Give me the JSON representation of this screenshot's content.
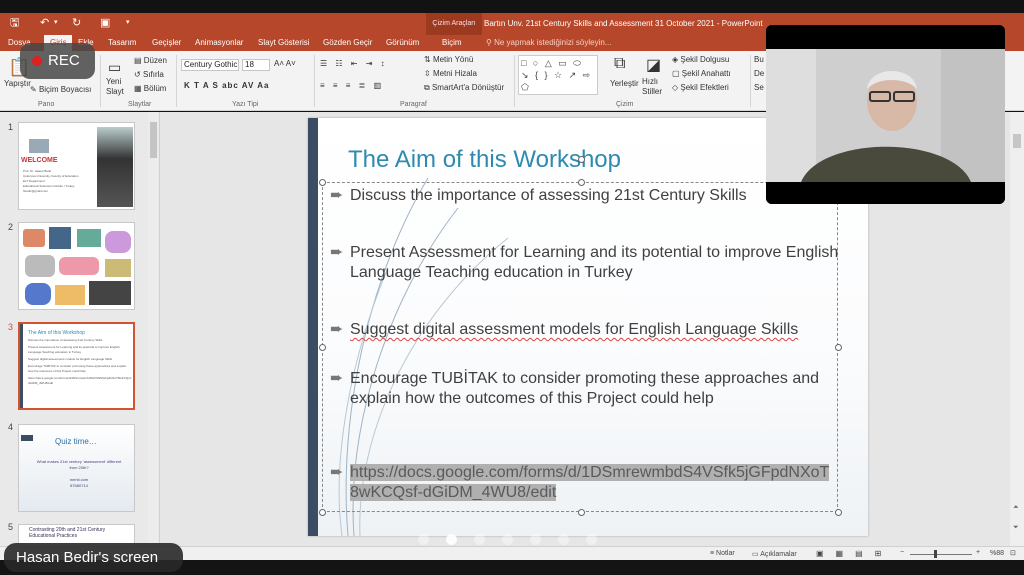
{
  "app": {
    "document_title": "Bartın Unv. 21st Century Skills and Assessment 31 October 2021 - PowerPoint",
    "context_tab_group": "Çizim Araçları",
    "tell_me": "Ne yapmak istediğinizi söyleyin..."
  },
  "ribbon_tabs": [
    {
      "label": "Dosya"
    },
    {
      "label": "Giriş"
    },
    {
      "label": "Ekle"
    },
    {
      "label": "Tasarım"
    },
    {
      "label": "Geçişler"
    },
    {
      "label": "Animasyonlar"
    },
    {
      "label": "Slayt Gösterisi"
    },
    {
      "label": "Gözden Geçir"
    },
    {
      "label": "Görünüm"
    },
    {
      "label": "Biçim"
    }
  ],
  "ribbon": {
    "paste": "Yapıştır",
    "format_painter": "Biçim Boyacısı",
    "group_clipboard": "Pano",
    "new_slide": "Yeni Slayt",
    "layout": "Düzen",
    "reset": "Sıfırla",
    "section": "Bölüm",
    "group_slides": "Slaytlar",
    "font_name": "Century Gothic",
    "font_size": "18",
    "font_buttons": "K  T  A  S  abc  AV  Aa",
    "group_font": "Yazı Tipi",
    "text_direction": "Metin Yönü",
    "align_text": "Metni Hizala",
    "smartart": "SmartArt'a Dönüştür",
    "group_paragraph": "Paragraf",
    "shape_glyphs": "□ ○ △ ▭ ⬭ ↘ { } ☆ ↗ ⇨ ⬠",
    "arrange": "Yerleştir",
    "quick_styles": "Hızlı Stiller",
    "shape_fill": "Şekil Dolgusu",
    "shape_outline": "Şekil Anahattı",
    "shape_effects": "Şekil Efektleri",
    "group_drawing": "Çizim",
    "find_cut": "Bu",
    "replace_cut": "De",
    "select_cut": "Se"
  },
  "thumbnails": [
    {
      "num": "1",
      "title": "WELCOME",
      "lines": [
        "Prof. Dr. Hasan Bedir",
        "Çukurova University, Faculty of Education",
        "ELT Department",
        "Educational Sciences Institute / Turkey",
        "hbedir@gmail.com"
      ]
    },
    {
      "num": "2",
      "title": "",
      "lines": []
    },
    {
      "num": "3",
      "title": "The Aim of this Workshop",
      "lines": [
        "Discuss the importance of assessing 21st Century Skills",
        "Present Assessment for Learning and its potential to improve English Language Teaching education in Turkey",
        "Suggest digital assessment models for English Language Skills",
        "Encourage TUBİTAK to consider promoting these approaches and explain how the outcomes of this Project could help",
        "https://docs.google.com/forms/d/1DSmrewmbdS4VSfk5jGFpdNXoT8wKCQsf-dGiDM_4WU8/edit"
      ]
    },
    {
      "num": "4",
      "title": "Quiz time…",
      "lines": [
        "What makes 21st century 'assessment' different from 20th?",
        "menti.com",
        "87680714"
      ]
    },
    {
      "num": "5",
      "title": "Contrasting 20th and 21st Century Educational Practices",
      "lines": []
    }
  ],
  "slide": {
    "title": "The Aim of this Workshop",
    "bullets": [
      "Discuss the importance of assessing 21st Century Skills",
      "Present Assessment for Learning and its potential to improve English Language Teaching education in Turkey",
      "Suggest digital assessment models for English Language Skills",
      "Encourage TUBİTAK to consider promoting these approaches and explain how the outcomes of this Project could help",
      "https://docs.google.com/forms/d/1DSmrewmbdS4VSfk5jGFpdNXoT8wKCQsf-dGiDM_4WU8/edit"
    ]
  },
  "status_bar": {
    "notes": "Notlar",
    "comments": "Açıklamalar",
    "zoom_percent": "%88"
  },
  "overlay": {
    "rec_label": "REC",
    "presenter_screen": "Hasan Bedir's screen"
  },
  "colors": {
    "ppt_accent": "#b7472a",
    "slide_title": "#2e8ab0",
    "slide_bar": "#3b4d63",
    "rec_dot": "#e02020"
  }
}
